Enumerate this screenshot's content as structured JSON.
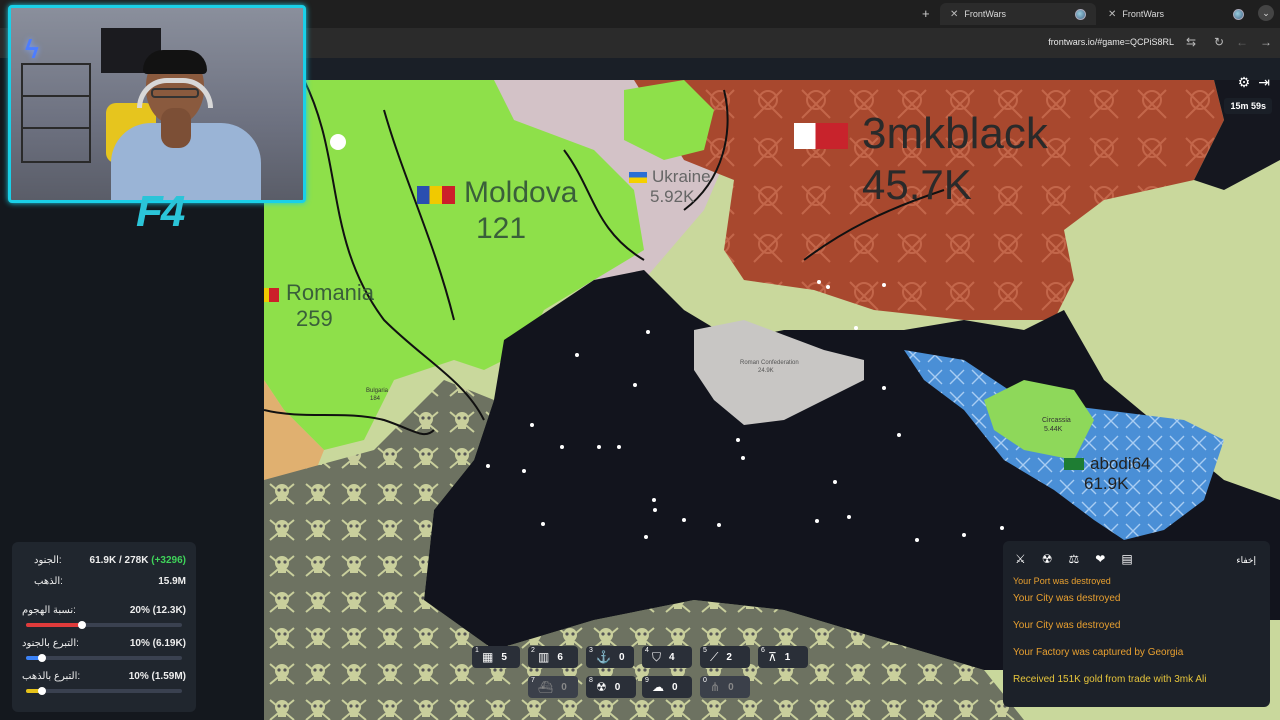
{
  "browser": {
    "tabs": [
      {
        "title": "FrontWars",
        "active": true
      },
      {
        "title": "FrontWars",
        "active": false
      }
    ],
    "url": "frontwars.io/#game=QCPiS8RL",
    "new_tab": "+"
  },
  "webcam": {
    "logo": "F4"
  },
  "map": {
    "players": [
      {
        "name": "3mkblack",
        "troops": "45.7K"
      },
      {
        "name": "Moldova",
        "troops": "121"
      },
      {
        "name": "Ukraine",
        "troops": "5.92K"
      },
      {
        "name": "Romania",
        "troops": "259"
      },
      {
        "name": "abodi64",
        "troops": "61.9K"
      },
      {
        "name": "Roman Confederation",
        "troops": "24.9K"
      },
      {
        "name": "Bulgaria",
        "troops": "184"
      },
      {
        "name": "Circassia",
        "troops": "5.44K"
      }
    ]
  },
  "hud": {
    "timer": "15m 59s",
    "settings_icon": "gear-icon",
    "exit_icon": "exit-icon"
  },
  "stats": {
    "troops_label": "الجنود:",
    "troops_value": "61.9K / 278K",
    "troops_delta": "(+3296)",
    "gold_label": "الذهب:",
    "gold_value": "15.9M",
    "attack_label": "نسبة الهجوم:",
    "attack_value": "20% (12.3K)",
    "attack_ratio": 0.2,
    "donate_troops_label": "التبرع بالجنود:",
    "donate_troops_value": "10% (6.19K)",
    "donate_troops_ratio": 0.1,
    "donate_gold_label": "التبرع بالذهب:",
    "donate_gold_value": "10% (1.59M)",
    "donate_gold_ratio": 0.1,
    "colors": {
      "attack": "#e03b3b",
      "troops": "#3b82f6",
      "gold": "#e6c219"
    }
  },
  "build_bar": {
    "row1": [
      {
        "key": "1",
        "icon": "city-icon",
        "count": "5"
      },
      {
        "key": "2",
        "icon": "factory-icon",
        "count": "6"
      },
      {
        "key": "3",
        "icon": "port-icon",
        "count": "0"
      },
      {
        "key": "4",
        "icon": "defense-post-icon",
        "count": "4"
      },
      {
        "key": "5",
        "icon": "missile-silo-icon",
        "count": "2"
      },
      {
        "key": "6",
        "icon": "sam-launcher-icon",
        "count": "1"
      }
    ],
    "row2": [
      {
        "key": "7",
        "icon": "warship-icon",
        "count": "0",
        "disabled": true
      },
      {
        "key": "8",
        "icon": "atom-bomb-icon",
        "count": "0",
        "disabled": false
      },
      {
        "key": "9",
        "icon": "hydrogen-bomb-icon",
        "count": "0",
        "disabled": false
      },
      {
        "key": "0",
        "icon": "mirv-icon",
        "count": "0",
        "disabled": true
      }
    ]
  },
  "events": {
    "hide_label": "إخفاء",
    "filters": [
      "attack-filter-icon",
      "nuke-filter-icon",
      "trade-filter-icon",
      "alliance-filter-icon",
      "chat-filter-icon"
    ],
    "items": [
      {
        "text": "Your Port was destroyed",
        "kind": "bad"
      },
      {
        "text": "Your City was destroyed",
        "kind": "bad"
      },
      {
        "text": "Your City was destroyed",
        "kind": "bad"
      },
      {
        "text": "Your Factory was captured by Georgia",
        "kind": "bad"
      },
      {
        "text": "Received 151K gold from trade with 3mk Ali",
        "kind": "good"
      }
    ]
  }
}
